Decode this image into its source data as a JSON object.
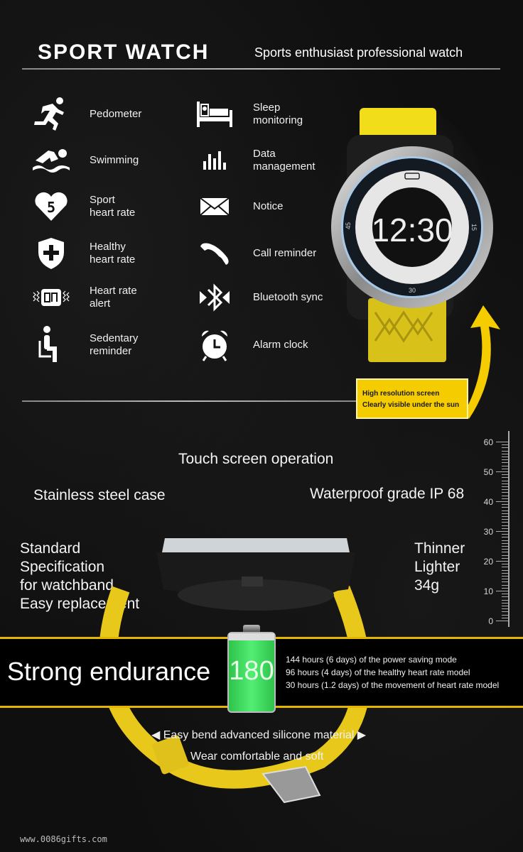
{
  "header": {
    "title": "SPORT WATCH",
    "subtitle": "Sports enthusiast professional watch"
  },
  "features_left": [
    {
      "icon": "running-person-icon",
      "label": "Pedometer"
    },
    {
      "icon": "swimmer-icon",
      "label": "Swimming"
    },
    {
      "icon": "heart-5-icon",
      "label": "Sport\nheart rate"
    },
    {
      "icon": "shield-plus-icon",
      "label": "Healthy\nheart rate"
    },
    {
      "icon": "vibrating-alert-icon",
      "label": "Heart rate\nalert"
    },
    {
      "icon": "seated-person-icon",
      "label": "Sedentary\nreminder"
    }
  ],
  "features_right": [
    {
      "icon": "bed-icon",
      "label": "Sleep\nmonitoring"
    },
    {
      "icon": "bar-chart-icon",
      "label": "Data\nmanagement"
    },
    {
      "icon": "envelope-icon",
      "label": "Notice"
    },
    {
      "icon": "phone-handset-icon",
      "label": "Call reminder"
    },
    {
      "icon": "bluetooth-icon",
      "label": "Bluetooth sync"
    },
    {
      "icon": "alarm-clock-icon",
      "label": "Alarm clock"
    }
  ],
  "watch": {
    "time": "12:30",
    "bezel_labels": [
      "45",
      "15",
      "30"
    ]
  },
  "callout": {
    "line1": "High resolution screen",
    "line2": "Clearly visible under the sun"
  },
  "specs": {
    "touch": "Touch screen operation",
    "case": "Stainless steel case",
    "waterproof": "Waterproof grade IP 68",
    "band": [
      "Standard",
      "Specification",
      "for watchband",
      "Easy replacement"
    ],
    "weight": [
      "Thinner",
      "Lighter",
      "34g"
    ]
  },
  "ruler": {
    "labels": [
      "60",
      "50",
      "40",
      "30",
      "20",
      "10",
      "0"
    ]
  },
  "endurance": {
    "title": "Strong endurance",
    "battery_value": "180",
    "lines": [
      "144 hours (6 days) of the power saving mode",
      "96 hours (4 days) of the healthy heart rate model",
      "30 hours (1.2 days) of the movement of heart rate model"
    ]
  },
  "material": {
    "line1": "◀ Easy bend advanced silicone material ▶",
    "line2": "Wear comfortable and soft"
  },
  "footer": {
    "website": "www.0086gifts.com"
  },
  "colors": {
    "accent_yellow": "#f5cc00",
    "battery_green": "#3ddc5a",
    "background": "#0f0f0f"
  }
}
